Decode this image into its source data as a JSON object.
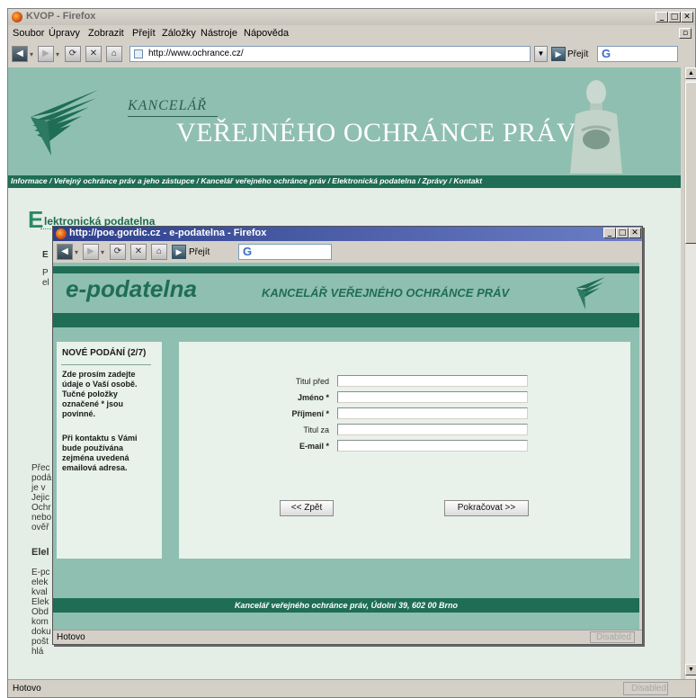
{
  "outer_window": {
    "title": "KVOP - Firefox",
    "controls": {
      "minimize": "_",
      "maximize": "□",
      "close": "✕"
    },
    "menu": [
      "Soubor",
      "Úpravy",
      "Zobrazit",
      "Přejít",
      "Záložky",
      "Nástroje",
      "Nápověda"
    ],
    "url": "http://www.ochrance.cz/",
    "go_label": "Přejít",
    "search_logo": "G",
    "status": "Hotovo",
    "status_right": "Disabled"
  },
  "site": {
    "kancelar": "KANCELÁŘ",
    "title": "VEŘEJNÉHO OCHRÁNCE PRÁV",
    "nav": "Informace  /  Veřejný ochránce práv  a jeho zástupce  /  Kancelář veřejného ochránce práv  /  Elektronická podatelna  /  Zprávy  /  Kontakt",
    "heading_big_letter": "E",
    "heading_rest": "lektronická podatelna",
    "fragments_top": [
      "E",
      "P",
      "el"
    ],
    "fragments_mid": [
      "Přec",
      "podá",
      "je v",
      "Jejic",
      "Ochr",
      "nebo",
      "ověř"
    ],
    "fragment_bold": "Elel",
    "fragments_bottom": [
      "E-pc",
      "elek",
      "kval",
      "Elek",
      "Obd",
      "kom",
      "doku",
      "pošt",
      "hlá"
    ]
  },
  "popup": {
    "title": "http://poe.gordic.cz - e-podatelna - Firefox",
    "controls": {
      "minimize": "_",
      "maximize": "□",
      "close": "✕"
    },
    "go_label": "Přejít",
    "search_logo": "G",
    "status": "Hotovo",
    "status_right": "Disabled",
    "page": {
      "brand": "e-podatelna",
      "subtitle": "KANCELÁŘ VEŘEJNÉHO OCHRÁNCE PRÁV",
      "sidebar": {
        "heading": "NOVÉ PODÁNÍ (2/7)",
        "para1": "Zde prosím zadejte údaje o Vaší osobě. Tučné položky označené * jsou povinné.",
        "para2": "Při kontaktu s Vámi bude používána zejména uvedená emailová adresa."
      },
      "form": {
        "fields": [
          {
            "label": "Titul před",
            "value": "",
            "required": false
          },
          {
            "label": "Jméno *",
            "value": "",
            "required": true
          },
          {
            "label": "Příjmení *",
            "value": "",
            "required": true
          },
          {
            "label": "Titul za",
            "value": "",
            "required": false
          },
          {
            "label": "E-mail *",
            "value": "",
            "required": true
          }
        ],
        "back_label": "<< Zpět",
        "next_label": "Pokračovat >>"
      },
      "footer": "Kancelář veřejného ochránce práv, Údolní 39, 602 00 Brno"
    }
  }
}
